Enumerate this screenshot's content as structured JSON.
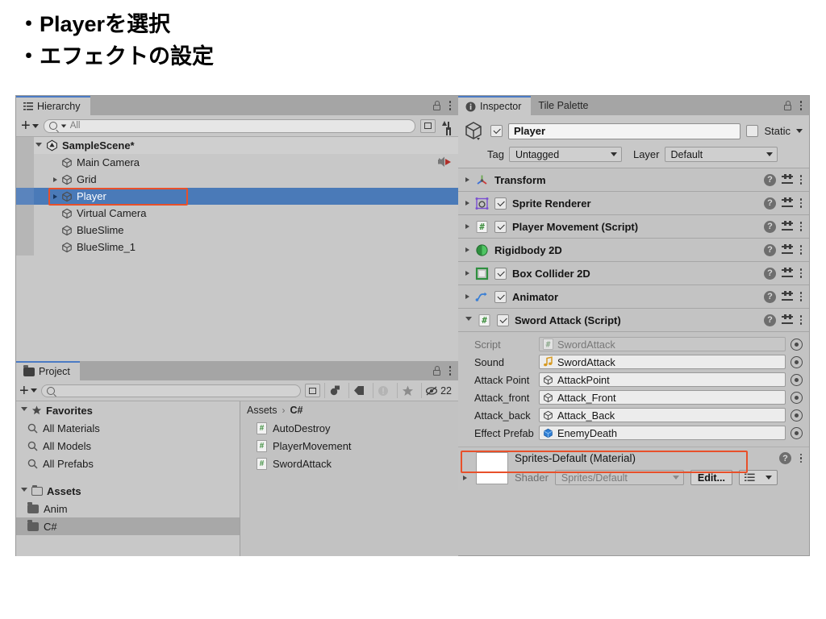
{
  "slide": {
    "bullets": [
      "・Playerを選択",
      "・エフェクトの設定"
    ]
  },
  "hierarchy": {
    "tab_label": "Hierarchy",
    "add_label": "+",
    "search_placeholder": "All",
    "items": [
      {
        "label": "SampleScene*",
        "indent": 0,
        "arrow": "open",
        "icon": "unity-scene-icon",
        "selected": false,
        "extra_icon": ""
      },
      {
        "label": "Main Camera",
        "indent": 1,
        "arrow": "none",
        "icon": "gameobject-cube-icon",
        "selected": false,
        "extra_icon": "audio-listener-icon"
      },
      {
        "label": "Grid",
        "indent": 1,
        "arrow": "closed",
        "icon": "gameobject-cube-icon",
        "selected": false,
        "extra_icon": ""
      },
      {
        "label": "Player",
        "indent": 1,
        "arrow": "closed",
        "icon": "gameobject-cube-icon",
        "selected": true,
        "extra_icon": ""
      },
      {
        "label": "Virtual Camera",
        "indent": 1,
        "arrow": "none",
        "icon": "gameobject-cube-icon",
        "selected": false,
        "extra_icon": ""
      },
      {
        "label": "BlueSlime",
        "indent": 1,
        "arrow": "none",
        "icon": "gameobject-cube-icon",
        "selected": false,
        "extra_icon": ""
      },
      {
        "label": "BlueSlime_1",
        "indent": 1,
        "arrow": "none",
        "icon": "gameobject-cube-icon",
        "selected": false,
        "extra_icon": ""
      }
    ]
  },
  "project": {
    "tab_label": "Project",
    "add_label": "+",
    "search_placeholder": "",
    "hidden_count": "22",
    "breadcrumb": [
      "Assets",
      "C#"
    ],
    "tree": [
      {
        "label": "Favorites",
        "type": "header",
        "icon": "star-icon",
        "arrow": "open",
        "selected": false
      },
      {
        "label": "All Materials",
        "type": "search",
        "icon": "search-icon",
        "arrow": "none",
        "selected": false
      },
      {
        "label": "All Models",
        "type": "search",
        "icon": "search-icon",
        "arrow": "none",
        "selected": false
      },
      {
        "label": "All Prefabs",
        "type": "search",
        "icon": "search-icon",
        "arrow": "none",
        "selected": false
      },
      {
        "label": "",
        "type": "spacer",
        "icon": "",
        "arrow": "none",
        "selected": false
      },
      {
        "label": "Assets",
        "type": "header",
        "icon": "folder-open-icon",
        "arrow": "open",
        "selected": false
      },
      {
        "label": "Anim",
        "type": "folder",
        "icon": "folder-icon",
        "arrow": "none",
        "selected": false
      },
      {
        "label": "C#",
        "type": "folder",
        "icon": "folder-icon",
        "arrow": "none",
        "selected": true
      }
    ],
    "files": [
      {
        "label": "AutoDestroy",
        "icon": "csharp-script-icon"
      },
      {
        "label": "PlayerMovement",
        "icon": "csharp-script-icon"
      },
      {
        "label": "SwordAttack",
        "icon": "csharp-script-icon"
      }
    ]
  },
  "inspector": {
    "tabs": [
      {
        "label": "Inspector",
        "active": true,
        "icon": "info-icon"
      },
      {
        "label": "Tile Palette",
        "active": false,
        "icon": ""
      }
    ],
    "object_name": "Player",
    "object_enabled": true,
    "static_label": "Static",
    "static_checked": false,
    "tag_label": "Tag",
    "tag_value": "Untagged",
    "layer_label": "Layer",
    "layer_value": "Default",
    "components": [
      {
        "name": "Transform",
        "expanded": false,
        "has_checkbox": false,
        "checked": false,
        "icon": "transform-icon"
      },
      {
        "name": "Sprite Renderer",
        "expanded": false,
        "has_checkbox": true,
        "checked": true,
        "icon": "sprite-renderer-icon"
      },
      {
        "name": "Player Movement (Script)",
        "expanded": false,
        "has_checkbox": true,
        "checked": true,
        "icon": "csharp-script-icon"
      },
      {
        "name": "Rigidbody 2D",
        "expanded": false,
        "has_checkbox": false,
        "checked": false,
        "icon": "rigidbody2d-icon"
      },
      {
        "name": "Box Collider 2D",
        "expanded": false,
        "has_checkbox": true,
        "checked": true,
        "icon": "boxcollider2d-icon"
      },
      {
        "name": "Animator",
        "expanded": false,
        "has_checkbox": true,
        "checked": true,
        "icon": "animator-icon"
      },
      {
        "name": "Sword Attack (Script)",
        "expanded": true,
        "has_checkbox": true,
        "checked": true,
        "icon": "csharp-script-icon"
      }
    ],
    "sword_attack_props": [
      {
        "label": "Script",
        "value": "SwordAttack",
        "icon": "csharp-script-icon",
        "dim": true,
        "highlight": false
      },
      {
        "label": "Sound",
        "value": "SwordAttack",
        "icon": "audioclip-icon",
        "dim": false,
        "highlight": false
      },
      {
        "label": "Attack Point",
        "value": "AttackPoint",
        "icon": "gameobject-cube-icon",
        "dim": false,
        "highlight": false
      },
      {
        "label": "Attack_front",
        "value": "Attack_Front",
        "icon": "gameobject-cube-icon",
        "dim": false,
        "highlight": false
      },
      {
        "label": "Attack_back",
        "value": "Attack_Back",
        "icon": "gameobject-cube-icon",
        "dim": false,
        "highlight": false
      },
      {
        "label": "Effect Prefab",
        "value": "EnemyDeath",
        "icon": "prefab-cube-icon",
        "dim": false,
        "highlight": true
      }
    ],
    "material": {
      "title": "Sprites-Default (Material)",
      "shader_label": "Shader",
      "shader_value": "Sprites/Default",
      "edit_label": "Edit..."
    }
  },
  "colors": {
    "selection_blue": "#4a7ab8",
    "annotation_red": "#e8502a",
    "panel_bg": "#c8c8c8",
    "tab_active": "#c8c8c8",
    "tab_inactive": "#a5a5a5"
  }
}
